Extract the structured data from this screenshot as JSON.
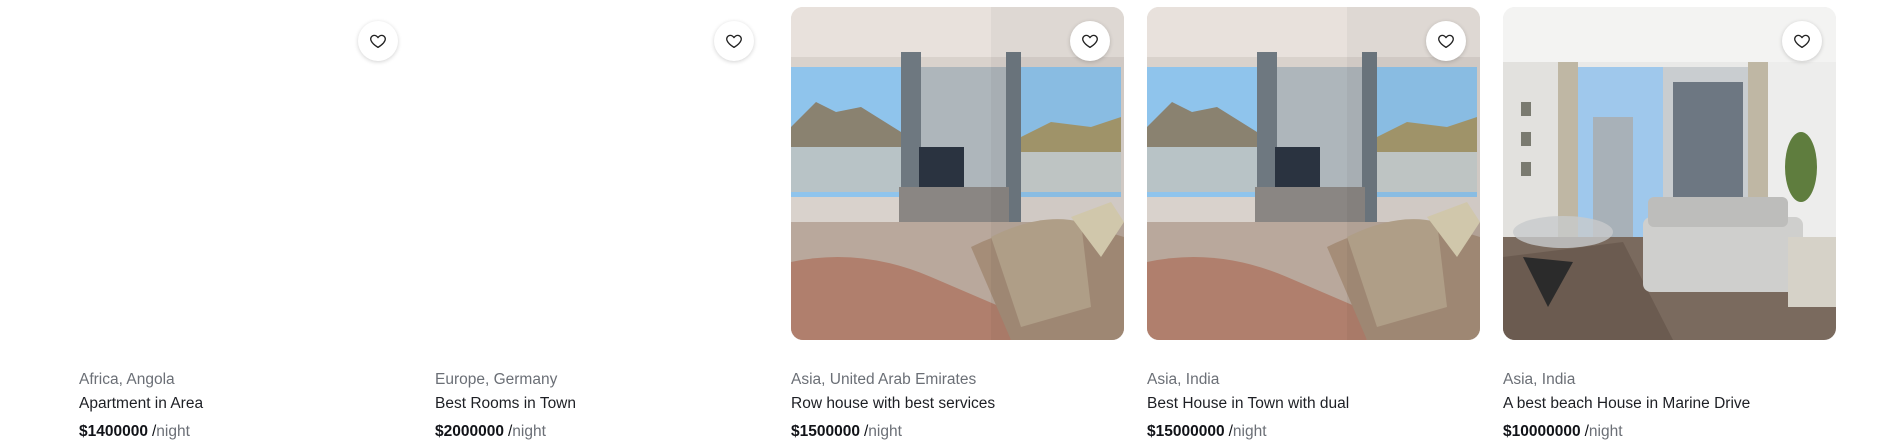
{
  "listings": [
    {
      "location": "Africa, Angola",
      "title": "Apartment in Area",
      "price": "$1400000",
      "unit": "night",
      "has_image": false,
      "favorite_icon": "heart-outline-icon"
    },
    {
      "location": "Europe, Germany",
      "title": "Best Rooms in Town",
      "price": "$2000000",
      "unit": "night",
      "has_image": false,
      "favorite_icon": "heart-outline-icon"
    },
    {
      "location": "Asia, United Arab Emirates",
      "title": "Row house with best services",
      "price": "$1500000",
      "unit": "night",
      "has_image": true,
      "favorite_icon": "heart-outline-icon"
    },
    {
      "location": "Asia, India",
      "title": "Best House in Town with dual",
      "price": "$15000000",
      "unit": "night",
      "has_image": true,
      "favorite_icon": "heart-outline-icon"
    },
    {
      "location": "Asia, India",
      "title": "A best beach House in Marine Drive",
      "price": "$10000000",
      "unit": "night",
      "has_image": true,
      "favorite_icon": "heart-outline-icon"
    }
  ],
  "colors": {
    "location_text": "#6b6f76",
    "title_text": "#1d1f24",
    "price_text": "#111318",
    "unit_text": "#6b6f76"
  }
}
